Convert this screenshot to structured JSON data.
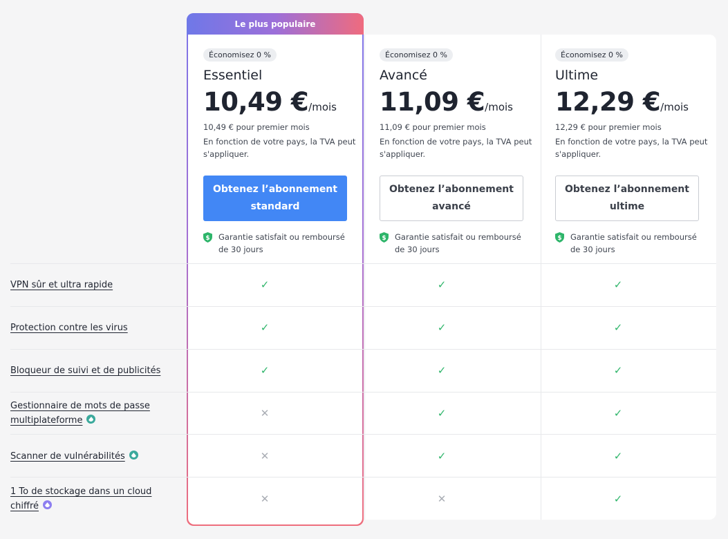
{
  "popular_label": "Le plus populaire",
  "colors": {
    "accent": "#4287f5",
    "check": "#2eb56a",
    "cross": "#a9adb4",
    "shield": "#2eb56a"
  },
  "plans": [
    {
      "save": "Économisez 0 %",
      "name": "Essentiel",
      "price": "10,49 €",
      "unit": "/mois",
      "first_month": "10,49 € pour premier mois",
      "vat": "En fonction de votre pays, la TVA peut s'appliquer.",
      "cta": "Obtenez l’abonnement standard",
      "guarantee": "Garantie satisfait ou remboursé de 30 jours"
    },
    {
      "save": "Économisez 0 %",
      "name": "Avancé",
      "price": "11,09 €",
      "unit": "/mois",
      "first_month": "11,09 € pour premier mois",
      "vat": "En fonction de votre pays, la TVA peut s'appliquer.",
      "cta": "Obtenez l’abonnement avancé",
      "guarantee": "Garantie satisfait ou remboursé de 30 jours"
    },
    {
      "save": "Économisez 0 %",
      "name": "Ultime",
      "price": "12,29 €",
      "unit": "/mois",
      "first_month": "12,29 € pour premier mois",
      "vat": "En fonction de votre pays, la TVA peut s'appliquer.",
      "cta": "Obtenez l’abonnement ultime",
      "guarantee": "Garantie satisfait ou remboursé de 30 jours"
    }
  ],
  "features": [
    {
      "label": "VPN sûr et ultra rapide",
      "addon": "",
      "included": [
        true,
        true,
        true
      ]
    },
    {
      "label": "Protection contre les virus",
      "addon": "",
      "included": [
        true,
        true,
        true
      ]
    },
    {
      "label": "Bloqueur de suivi et de publicités",
      "addon": "",
      "included": [
        true,
        true,
        true
      ]
    },
    {
      "label": "Gestionnaire de mots de passe multiplateforme",
      "addon": "teal-addon-icon",
      "included": [
        false,
        true,
        true
      ]
    },
    {
      "label": "Scanner de vulnérabilités",
      "addon": "teal-addon-icon",
      "included": [
        false,
        true,
        true
      ]
    },
    {
      "label": "1 To de stockage dans un cloud chiffré",
      "addon": "purple-addon-icon",
      "included": [
        false,
        false,
        true
      ]
    }
  ]
}
